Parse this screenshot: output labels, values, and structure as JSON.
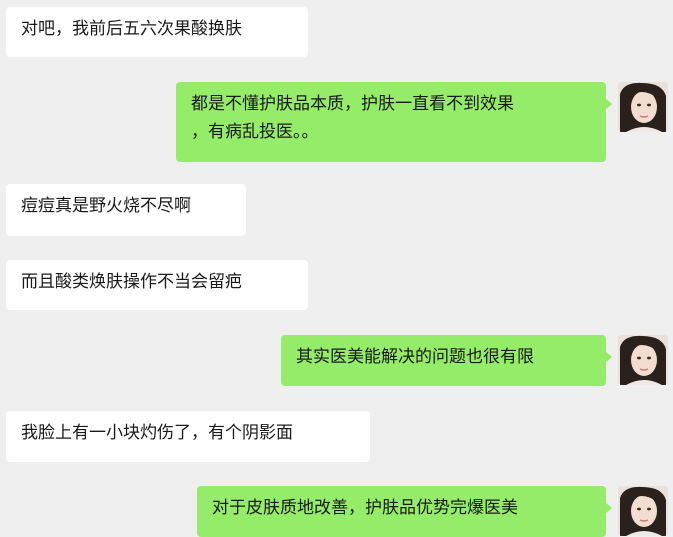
{
  "messages": [
    {
      "side": "incoming",
      "text": "对吧，我前后五六次果酸换肤"
    },
    {
      "side": "outgoing",
      "text": "都是不懂护肤品本质，护肤一直看不到效果\n，有病乱投医。。"
    },
    {
      "side": "incoming",
      "text": "痘痘真是野火烧不尽啊"
    },
    {
      "side": "incoming",
      "text": "而且酸类焕肤操作不当会留疤"
    },
    {
      "side": "outgoing",
      "text": "其实医美能解决的问题也很有限"
    },
    {
      "side": "incoming",
      "text": "我脸上有一小块灼伤了，有个阴影面"
    },
    {
      "side": "outgoing",
      "text": "对于皮肤质地改善，护肤品优势完爆医美"
    }
  ],
  "colors": {
    "background": "#efefef",
    "incoming_bubble": "#ffffff",
    "outgoing_bubble": "#95ec69"
  },
  "avatar_icon": "user-avatar-photo"
}
